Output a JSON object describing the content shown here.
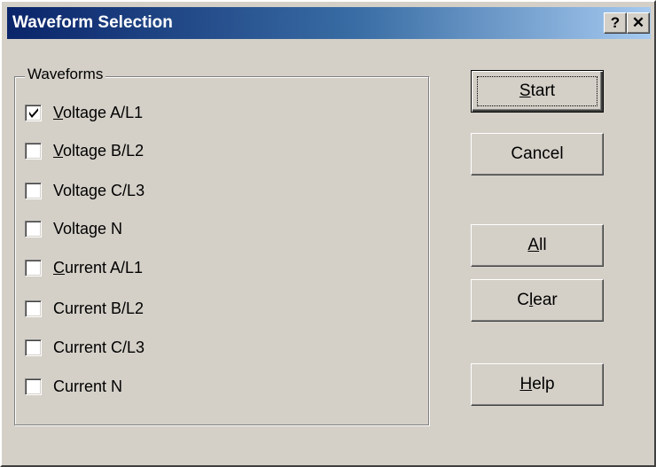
{
  "window": {
    "title": "Waveform Selection",
    "help_glyph": "?",
    "close_glyph": "✕"
  },
  "waveforms": {
    "group_label": "Waveforms",
    "items": [
      {
        "pre": "",
        "key": "V",
        "post": "oltage A/L1",
        "checked": true
      },
      {
        "pre": "",
        "key": "V",
        "post": "oltage B/L2",
        "checked": false
      },
      {
        "pre": "Voltage C/L3",
        "key": "",
        "post": "",
        "checked": false
      },
      {
        "pre": "Voltage N",
        "key": "",
        "post": "",
        "checked": false
      },
      {
        "pre": "",
        "key": "C",
        "post": "urrent A/L1",
        "checked": false
      },
      {
        "pre": "Current B/L2",
        "key": "",
        "post": "",
        "checked": false
      },
      {
        "pre": "Current C/L3",
        "key": "",
        "post": "",
        "checked": false
      },
      {
        "pre": "Current N",
        "key": "",
        "post": "",
        "checked": false
      }
    ]
  },
  "buttons": {
    "start": {
      "pre": "",
      "key": "S",
      "post": "tart"
    },
    "cancel": {
      "label": "Cancel"
    },
    "all": {
      "pre": "",
      "key": "A",
      "post": "ll"
    },
    "clear": {
      "pre": "C",
      "key": "l",
      "post": "ear"
    },
    "help": {
      "pre": "",
      "key": "H",
      "post": "elp"
    }
  },
  "icons": {
    "checkmark": "check-icon"
  }
}
